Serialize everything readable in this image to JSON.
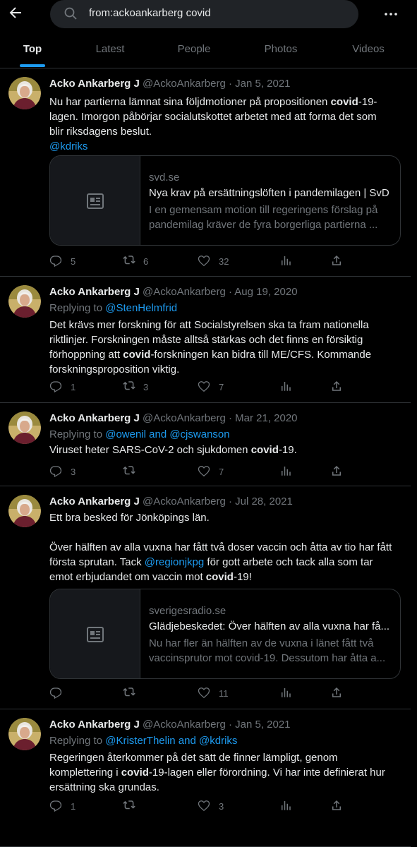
{
  "search": {
    "query": "from:ackoankarberg covid"
  },
  "icons": {
    "back": "arrow-left-icon",
    "search": "search-icon",
    "more": "more-dots-icon"
  },
  "tabs": [
    {
      "label": "Top",
      "active": true
    },
    {
      "label": "Latest",
      "active": false
    },
    {
      "label": "People",
      "active": false
    },
    {
      "label": "Photos",
      "active": false
    },
    {
      "label": "Videos",
      "active": false
    }
  ],
  "colors": {
    "accent": "#1d9bf0",
    "background": "#000000",
    "muted": "#71767b",
    "text": "#e7e9ea"
  },
  "tweets": [
    {
      "name": "Acko Ankarberg J",
      "handle": "@AckoAnkarberg",
      "date": "Jan 5, 2021",
      "body": [
        [
          "Nu har partierna lämnat sina följdmotioner på propositionen ",
          "covid",
          "-19-"
        ],
        [
          "lagen. Imorgon påbörjar socialutskottet arbetet med att forma det som"
        ],
        [
          "blir riksdagens beslut."
        ]
      ],
      "mention": "@kdriks",
      "card": {
        "domain": "svd.se",
        "title": "Nya krav på ersättningslöften i pandemilagen | SvD",
        "desc": [
          "I en gemensam motion till regeringens förslag på",
          "pandemilag kräver de fyra borgerliga partierna ..."
        ]
      },
      "stats": {
        "replies": "5",
        "retweets": "6",
        "likes": "32"
      }
    },
    {
      "name": "Acko Ankarberg J",
      "handle": "@AckoAnkarberg",
      "date": "Aug 19, 2020",
      "replying_prefix": "Replying to",
      "replying_to": "@StenHelmfrid",
      "body": [
        [
          "Det krävs mer forskning för att Socialstyrelsen ska ta fram nationella"
        ],
        [
          "riktlinjer. Forskningen måste alltså stärkas och det finns en försiktig"
        ],
        [
          "förhoppning att ",
          "covid",
          "-forskningen kan bidra till ME/CFS. Kommande"
        ],
        [
          "forskningsproposition viktig."
        ]
      ],
      "stats": {
        "replies": "1",
        "retweets": "3",
        "likes": "7"
      }
    },
    {
      "name": "Acko Ankarberg J",
      "handle": "@AckoAnkarberg",
      "date": "Mar 21, 2020",
      "replying_prefix": "Replying to",
      "replying_to": "@owenil and @cjswanson",
      "body": [
        [
          "Viruset heter SARS-CoV-2 och sjukdomen ",
          "covid",
          "-19."
        ]
      ],
      "stats": {
        "replies": "3",
        "retweets": "",
        "likes": "7"
      }
    },
    {
      "name": "Acko Ankarberg J",
      "handle": "@AckoAnkarberg",
      "date": "Jul 28, 2021",
      "body": [
        [
          "Ett bra besked för Jönköpings län."
        ],
        [
          ""
        ],
        [
          "Över hälften av alla vuxna har fått två doser vaccin och åtta av tio har fått"
        ],
        [
          "första sprutan. Tack ",
          "@regionjkpg",
          " för gott arbete och tack alla som tar"
        ],
        [
          "emot erbjudandet om vaccin mot ",
          "covid",
          "-19!"
        ]
      ],
      "card": {
        "domain": "sverigesradio.se",
        "title": "Glädjebeskedet: Över hälften av alla vuxna har få...",
        "desc": [
          "Nu har fler än hälften av de vuxna i länet fått två",
          "vaccinsprutor mot covid-19. Dessutom har åtta a..."
        ]
      },
      "stats": {
        "replies": "",
        "retweets": "",
        "likes": "11"
      }
    },
    {
      "name": "Acko Ankarberg J",
      "handle": "@AckoAnkarberg",
      "date": "Jan 5, 2021",
      "replying_prefix": "Replying to",
      "replying_to": "@KristerThelin and @kdriks",
      "body": [
        [
          "Regeringen återkommer på det sätt de finner lämpligt, genom"
        ],
        [
          "komplettering i ",
          "covid",
          "-19-lagen eller förordning. Vi har inte definierat hur"
        ],
        [
          "ersättning ska grundas."
        ]
      ],
      "stats": {
        "replies": "1",
        "retweets": "",
        "likes": "3"
      }
    }
  ]
}
